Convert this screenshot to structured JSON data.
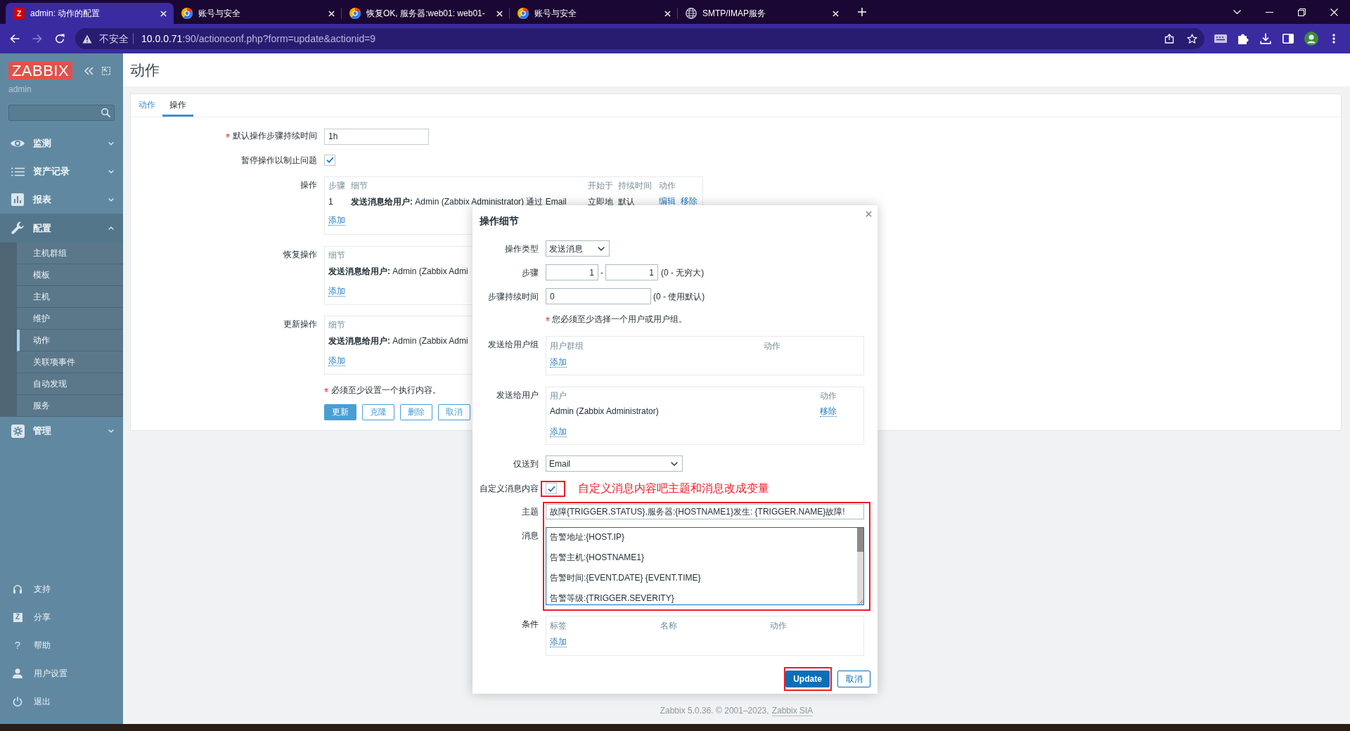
{
  "browser": {
    "tabs": [
      {
        "kind": "letter",
        "icon_text": "Z",
        "title": "admin: 动作的配置",
        "selected": true
      },
      {
        "kind": "round",
        "title": "账号与安全",
        "selected": false
      },
      {
        "kind": "round",
        "title": "恢复OK, 服务器:web01: web01-",
        "selected": false
      },
      {
        "kind": "round",
        "title": "账号与安全",
        "selected": false
      },
      {
        "kind": "globe",
        "title": "SMTP/IMAP服务",
        "selected": false
      }
    ],
    "address": {
      "security": "不安全",
      "host": "10.0.0.71",
      "path": ":90/actionconf.php?form=update&actionid=9"
    }
  },
  "sidebar": {
    "logo": "ZABBIX",
    "user": "admin",
    "menu": [
      {
        "label": "监测",
        "expanded": false
      },
      {
        "label": "资产记录",
        "expanded": false
      },
      {
        "label": "报表",
        "expanded": false
      },
      {
        "label": "配置",
        "expanded": true,
        "children": [
          {
            "label": "主机群组",
            "selected": false
          },
          {
            "label": "模板",
            "selected": false
          },
          {
            "label": "主机",
            "selected": false
          },
          {
            "label": "维护",
            "selected": false
          },
          {
            "label": "动作",
            "selected": true
          },
          {
            "label": "关联项事件",
            "selected": false
          },
          {
            "label": "自动发现",
            "selected": false
          },
          {
            "label": "服务",
            "selected": false
          }
        ]
      },
      {
        "label": "管理",
        "expanded": false
      }
    ],
    "footer_menu": [
      {
        "kind": "icon",
        "label": "支持"
      },
      {
        "kind": "tile",
        "icon_text": "Z",
        "label": "分享"
      },
      {
        "kind": "glyph",
        "icon_text": "?",
        "label": "帮助"
      },
      {
        "kind": "icon",
        "label": "用户设置"
      },
      {
        "kind": "icon",
        "label": "退出"
      }
    ]
  },
  "page": {
    "title": "动作",
    "tabs": [
      {
        "label": "动作",
        "selected": false
      },
      {
        "label": "操作",
        "selected": true
      }
    ],
    "form": {
      "default_duration": {
        "label": "默认操作步骤持续时间",
        "required": true,
        "value": "1h"
      },
      "pause_suppressed": {
        "label": "暂停操作以制止问题",
        "checked": true
      },
      "operations": {
        "label": "操作",
        "columns": [
          "步骤",
          "细节",
          "开始于",
          "持续时间",
          "动作"
        ],
        "rows": [
          {
            "step": "1",
            "details": "**发送消息给用户:** Admin (Zabbix Administrator) 通过 Email",
            "start": "立即地",
            "duration": "默认",
            "actions": [
              "编辑",
              "移除"
            ]
          }
        ],
        "add": "添加"
      },
      "recovery_operations": {
        "label": "恢复操作",
        "columns": [
          "细节"
        ],
        "rows": [
          {
            "details": "**发送消息给用户:** Admin (Zabbix Admi"
          }
        ],
        "add": "添加"
      },
      "update_operations": {
        "label": "更新操作",
        "columns": [
          "细节"
        ],
        "rows": [
          {
            "details": "**发送消息给用户:** Admin (Zabbix Admi"
          }
        ],
        "add": "添加"
      },
      "note": {
        "required": true,
        "text": "必须至少设置一个执行内容。"
      },
      "buttons": [
        {
          "label": "更新",
          "kind": "primary"
        },
        {
          "label": "克隆",
          "kind": "secondary"
        },
        {
          "label": "删除",
          "kind": "secondary"
        },
        {
          "label": "取消",
          "kind": "secondary"
        }
      ]
    }
  },
  "dialog": {
    "title": "操作细节",
    "operation_type": {
      "label": "操作类型",
      "value": "发送消息"
    },
    "steps": {
      "label": "步骤",
      "from": "1",
      "separator": "-",
      "to": "1",
      "hint": "(0 - 无穷大)"
    },
    "step_duration": {
      "label": "步骤持续时间",
      "value": "0",
      "hint": "(0 - 使用默认)"
    },
    "note": {
      "required": true,
      "text": "您必须至少选择一个用户或用户组。"
    },
    "user_groups": {
      "label": "发送给用户组",
      "columns": [
        "用户群组",
        "动作"
      ],
      "add": "添加"
    },
    "users": {
      "label": "发送给用户",
      "columns": [
        "用户",
        "动作"
      ],
      "rows": [
        {
          "name": "Admin (Zabbix Administrator)",
          "action": "移除"
        }
      ],
      "add": "添加"
    },
    "send_only_to": {
      "label": "仅送到",
      "value": "Email"
    },
    "custom_message": {
      "label": "自定义消息内容",
      "checked": true,
      "highlighted": true,
      "annotation": "自定义消息内容吧主题和消息改成变量"
    },
    "message_content": {
      "highlighted": true,
      "subject": {
        "label": "主题",
        "value": "故障{TRIGGER.STATUS},服务器:{HOSTNAME1}发生: {TRIGGER.NAME}故障!"
      },
      "message": {
        "label": "消息",
        "focused": true,
        "value": "告警地址:{HOST.IP}\n\n告警主机:{HOSTNAME1}\n\n告警时间:{EVENT.DATE} {EVENT.TIME}\n\n告警等级:{TRIGGER.SEVERITY}"
      }
    },
    "conditions": {
      "label": "条件",
      "columns": [
        "标签",
        "名称",
        "动作"
      ],
      "add": "添加"
    },
    "buttons": [
      {
        "label": "Update",
        "kind": "primary",
        "highlighted": true
      },
      {
        "label": "取消",
        "kind": "secondary",
        "highlighted": false
      }
    ]
  },
  "footer": {
    "text": "Zabbix 5.0.36. © 2001–2023,",
    "link": "Zabbix SIA"
  }
}
